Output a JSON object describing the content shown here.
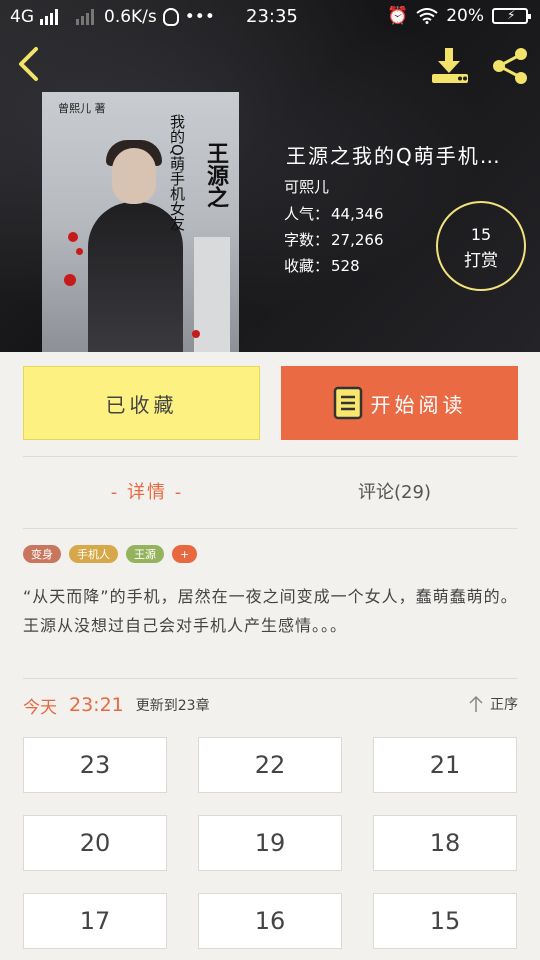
{
  "status_bar": {
    "network": "4G",
    "speed": "0.6K/s",
    "time": "23:35",
    "battery": "20%"
  },
  "book": {
    "title": "王源之我的Q萌手机…",
    "author": "可熙儿",
    "popularity_label": "人气：",
    "popularity": "44,346",
    "words_label": "字数：",
    "words": "27,266",
    "favorites_label": "收藏：",
    "favorites": "528",
    "tip_count": "15",
    "tip_label": "打赏",
    "cover": {
      "author_mark": "曾熙儿 著",
      "vertical_text_1": "我的Q萌手机女友",
      "vertical_text_2": "王源之"
    }
  },
  "actions": {
    "collected_label": "已收藏",
    "read_label": "开始阅读"
  },
  "tabs": {
    "detail": "- 详情 -",
    "comments": "评论(29)"
  },
  "tags": [
    {
      "label": "变身",
      "color": "#c9765f"
    },
    {
      "label": "手机人",
      "color": "#d7a84a"
    },
    {
      "label": "王源",
      "color": "#95b35e"
    },
    {
      "label": "+",
      "color": "#e8693f"
    }
  ],
  "description": "“从天而降”的手机，居然在一夜之间变成一个女人，蠢萌蠢萌的。王源从没想过自己会对手机人产生感情。。。",
  "update": {
    "today": "今天",
    "time": "23:21",
    "text": "更新到23章",
    "order_label": "正序"
  },
  "chapters": [
    "23",
    "22",
    "21",
    "20",
    "19",
    "18",
    "17",
    "16",
    "15"
  ],
  "colors": {
    "accent": "#e8693f",
    "collected_bg": "#fdf181",
    "tip_ring": "#f2e27c"
  }
}
